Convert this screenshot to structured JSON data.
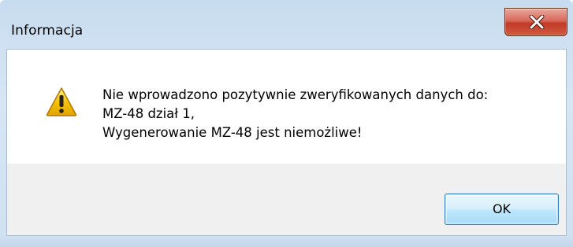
{
  "window": {
    "title": "Informacja",
    "close_icon": "close-x-icon"
  },
  "message": {
    "icon": "warning-icon",
    "lines": [
      "Nie wprowadzono pozytywnie zweryfikowanych danych do:",
      "MZ-48 dział 1,",
      "Wygenerowanie MZ-48 jest niemożliwe!"
    ]
  },
  "buttons": {
    "ok_label": "OK"
  },
  "colors": {
    "close_button": "#c23a26",
    "ok_button_border": "#3c7fb1",
    "footer_background": "#f0f0f0",
    "frame_background": "#cfe0f1",
    "warning_fill": "#f5c400"
  }
}
